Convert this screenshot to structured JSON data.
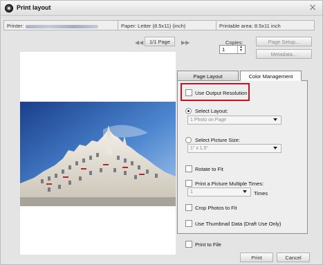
{
  "window": {
    "title": "Print layout",
    "close_glyph": "×"
  },
  "info": {
    "printer_label": "Printer:",
    "paper": "Paper: Letter (8.5x11) (inch)",
    "print_area": "Printable area: 8.5x11 inch"
  },
  "navigation": {
    "first_glyph": "◀◀",
    "page": "1/1 Page",
    "last_glyph": "▶▶"
  },
  "copies": {
    "label": "Copies:",
    "value": "1"
  },
  "buttons": {
    "page_setup": "Page Setup...",
    "metadata": "Metadata...",
    "print": "Print",
    "cancel": "Cancel"
  },
  "tabs": [
    {
      "label": "Page Layout",
      "active": false
    },
    {
      "label": "Color Management",
      "active": true
    }
  ],
  "options": {
    "use_output_resolution": "Use Output Resolution",
    "select_layout": "Select Layout:",
    "layout_value": "1 Photo on Page",
    "select_picture_size": "Select Picture Size:",
    "picture_size_value": "1\" x 1.5\"",
    "rotate_to_fit": "Rotate to Fit",
    "print_multiple": "Print a Picture Multiple Times:",
    "times_value": "1",
    "times_label": "Times",
    "crop_photos": "Crop Photos to Fit",
    "use_thumbnail": "Use Thumbnail Data (Draft Use Only)",
    "print_to_file": "Print to File"
  },
  "colors": {
    "highlight": "#c8101e",
    "window_bg": "#e4e4e4"
  },
  "icons": {
    "app": "app-logo-icon",
    "close": "close-icon",
    "first": "first-page-icon",
    "last": "last-page-icon",
    "dropdown": "chevron-down-icon"
  }
}
